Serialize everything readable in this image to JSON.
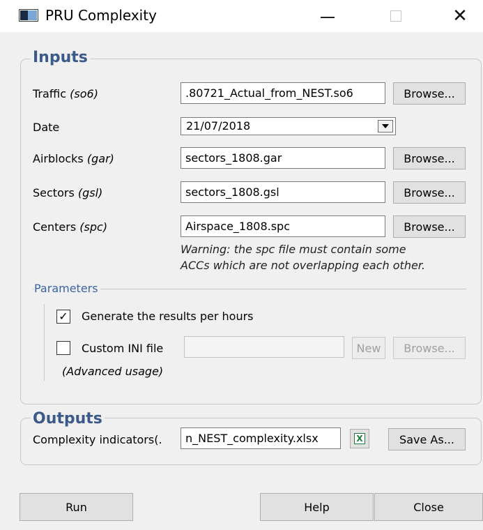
{
  "window": {
    "title": "PRU Complexity",
    "icons": {
      "app": "app-window-icon",
      "minimize": "minimize-icon",
      "maximize": "maximize-icon",
      "close": "close-icon"
    },
    "close_glyph": "✕"
  },
  "inputs": {
    "title": "Inputs",
    "traffic": {
      "label": "Traffic",
      "ext": "(so6)",
      "value": ".80721_Actual_from_NEST.so6",
      "browse": "Browse..."
    },
    "date": {
      "label": "Date",
      "value": "21/07/2018"
    },
    "airblocks": {
      "label": "Airblocks",
      "ext": "(gar)",
      "value": "sectors_1808.gar",
      "browse": "Browse..."
    },
    "sectors": {
      "label": "Sectors",
      "ext": "(gsl)",
      "value": "sectors_1808.gsl",
      "browse": "Browse..."
    },
    "centers": {
      "label": "Centers",
      "ext": "(spc)",
      "value": "Airspace_1808.spc",
      "browse": "Browse..."
    },
    "warning_line1": "Warning: the spc file must contain some",
    "warning_line2": "ACCs which are not overlapping each other."
  },
  "parameters": {
    "title": "Parameters",
    "per_hours": {
      "label": "Generate the results per hours",
      "checked": true,
      "check_glyph": "✓"
    },
    "custom_ini": {
      "label": "Custom INI file",
      "checked": false,
      "value": "",
      "new": "New",
      "browse": "Browse...",
      "note": "(Advanced usage)"
    }
  },
  "outputs": {
    "title": "Outputs",
    "complexity": {
      "label": "Complexity indicators(.",
      "value": "n_NEST_complexity.xlsx",
      "excel_icon": "excel-icon",
      "save_as": "Save As..."
    }
  },
  "footer": {
    "run": "Run",
    "help": "Help",
    "close": "Close"
  },
  "colors": {
    "group_title": "#3b5a8a",
    "params_title": "#3b63a8",
    "excel_green": "#1d7a3c"
  }
}
